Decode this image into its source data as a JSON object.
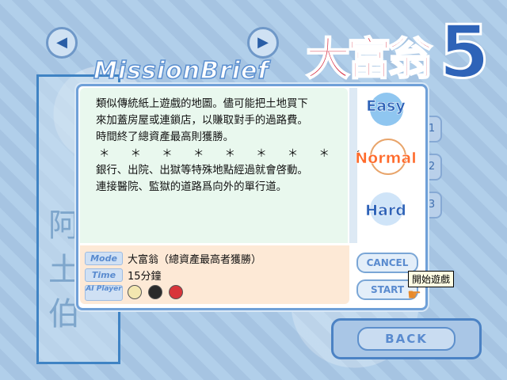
{
  "header": {
    "title_logo_cn": "大富翁",
    "title_logo_num": "5",
    "mission_title": "MissionBrief",
    "left_frame_text": "阿土伯"
  },
  "nav": {
    "prev_icon": "◀",
    "next_icon": "▶"
  },
  "brief": {
    "lines": [
      "類似傳統紙上遊戲的地圖。儘可能把土地買下",
      "來加蓋房屋或連鎖店，以賺取對手的過路費。",
      "時間終了總資產最高則獲勝。",
      "＊ ＊ ＊ ＊ ＊ ＊ ＊ ＊ ＊ ＊",
      "銀行、出院、出獄等特殊地點經過就會啓動。",
      "連接醫院、監獄的道路爲向外的單行道。"
    ]
  },
  "info": {
    "mode_label": "Mode",
    "mode_value": "大富翁（總資產最高者獲勝）",
    "time_label": "Time",
    "time_value": "15分鐘",
    "ai_label": "AI Player"
  },
  "difficulty": {
    "easy": "Easy",
    "normal": "Normal",
    "hard": "Hard"
  },
  "buttons": {
    "cancel": "CANCEL",
    "start": "START",
    "back": "BACK",
    "start_tooltip": "開始遊戲"
  },
  "right_tabs": [
    "1",
    "2",
    "3"
  ],
  "colors": {
    "background": "#a9c8e6",
    "brief_bg": "#e9f8ee",
    "info_bg": "#fde9d6",
    "accent_blue": "#2e63b8",
    "accent_orange": "#ff6b2c",
    "logo_red": "#d2233a"
  }
}
